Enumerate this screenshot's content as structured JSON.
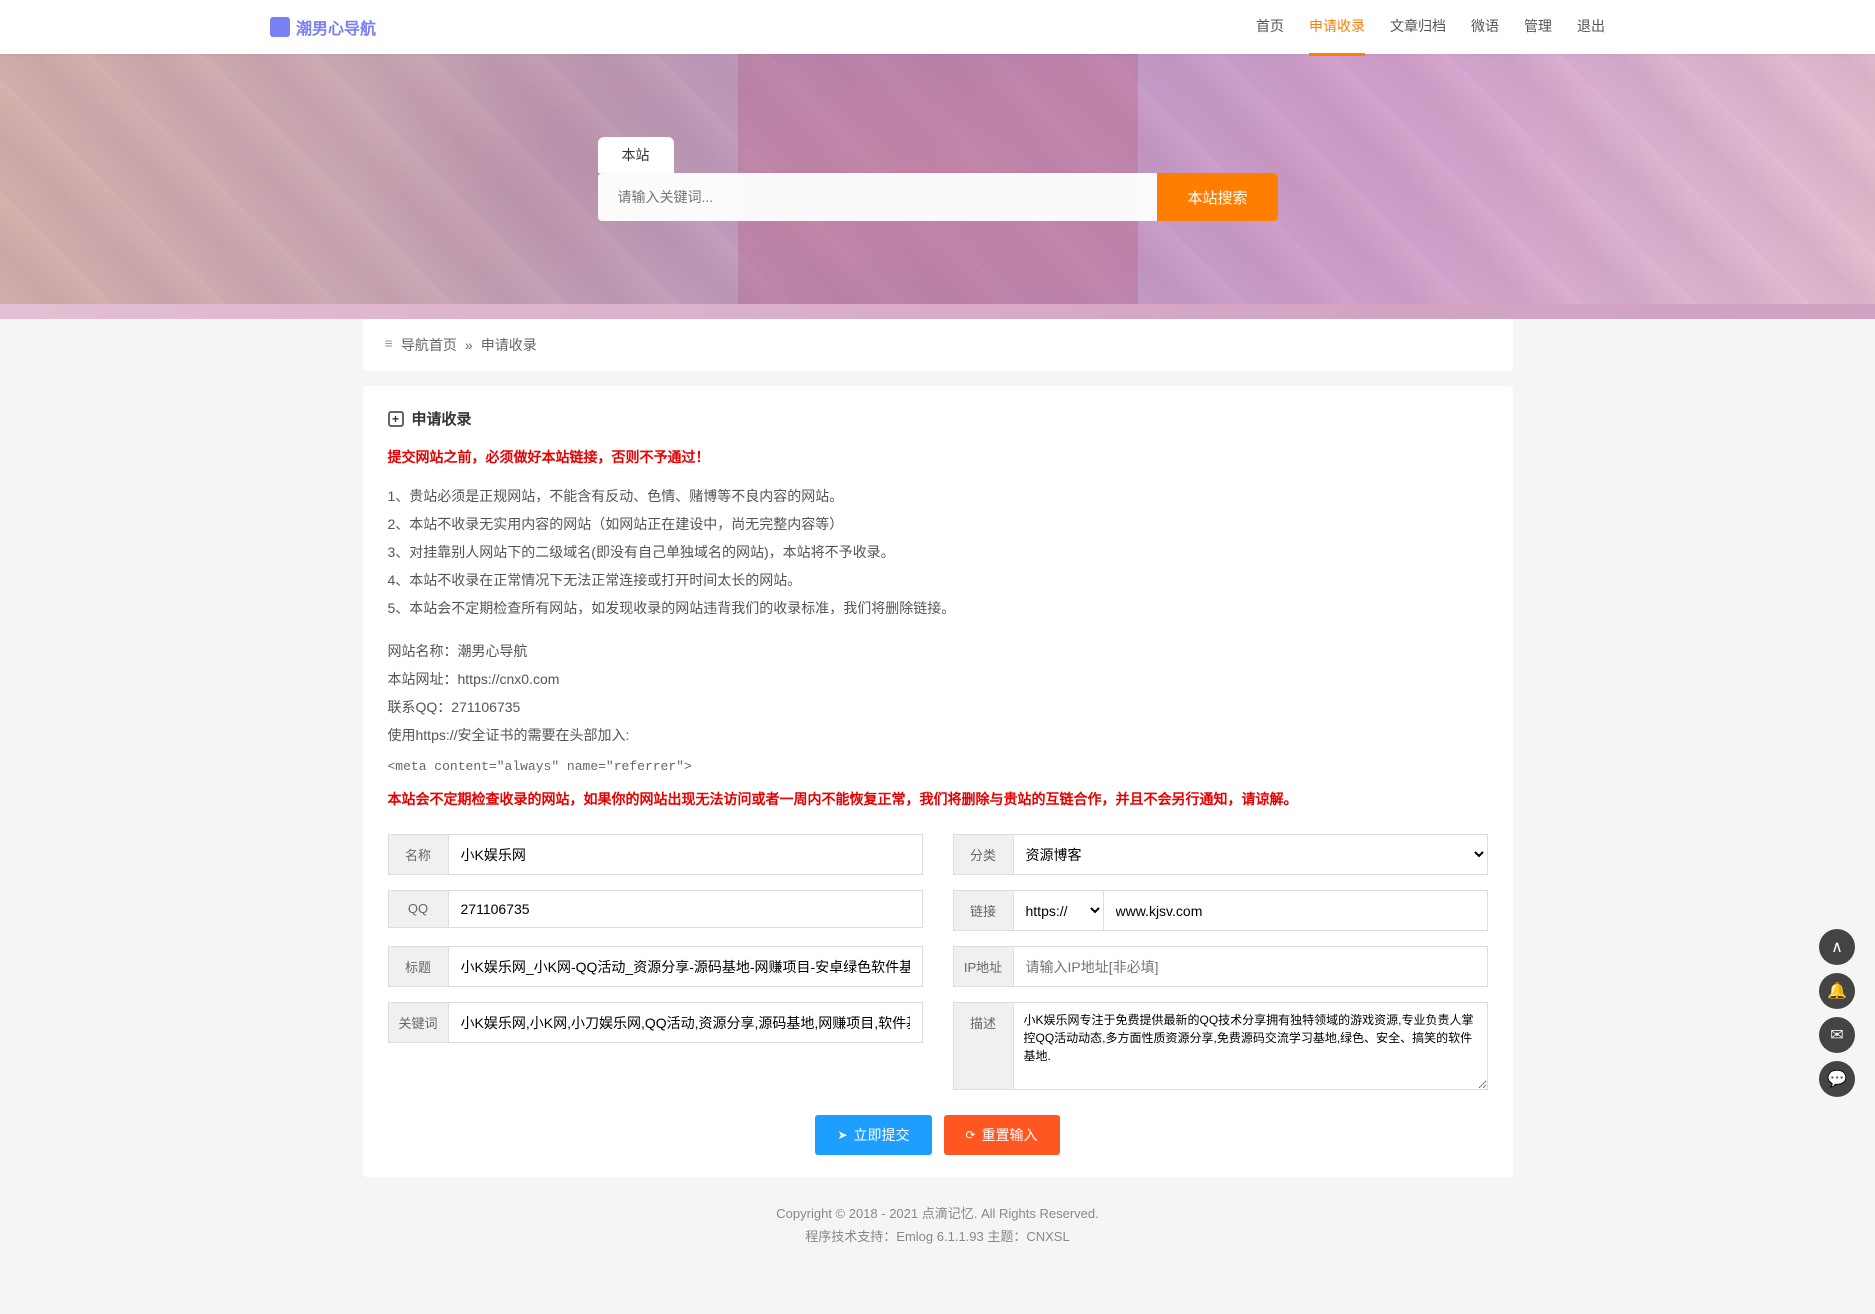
{
  "nav": {
    "logo": "潮男心导航",
    "items": [
      {
        "label": "首页"
      },
      {
        "label": "申请收录"
      },
      {
        "label": "文章归档"
      },
      {
        "label": "微语"
      },
      {
        "label": "管理"
      },
      {
        "label": "退出"
      }
    ]
  },
  "search": {
    "tab": "本站",
    "placeholder": "请输入关键词...",
    "button": "本站搜索"
  },
  "breadcrumb": {
    "home": "导航首页",
    "sep": "»",
    "current": "申请收录"
  },
  "panel": {
    "title": "申请收录",
    "warn_top": "提交网站之前，必须做好本站链接，否则不予通过！",
    "rules": [
      "1、贵站必须是正规网站，不能含有反动、色情、赌博等不良内容的网站。",
      "2、本站不收录无实用内容的网站（如网站正在建设中，尚无完整内容等）",
      "3、对挂靠别人网站下的二级域名(即没有自己单独域名的网站)，本站将不予收录。",
      "4、本站不收录在正常情况下无法正常连接或打开时间太长的网站。",
      "5、本站会不定期检查所有网站，如发现收录的网站违背我们的收录标准，我们将删除链接。"
    ],
    "info": [
      "网站名称：潮男心导航",
      "本站网址：https://cnx0.com",
      "联系QQ：271106735",
      "使用https://安全证书的需要在头部加入:"
    ],
    "code": "<meta content=\"always\" name=\"referrer\">",
    "warn_bottom": "本站会不定期检查收录的网站，如果你的网站出现无法访问或者一周内不能恢复正常，我们将删除与贵站的互链合作，并且不会另行通知，请谅解。"
  },
  "form": {
    "labels": {
      "name": "名称",
      "category": "分类",
      "qq": "QQ",
      "link": "链接",
      "title": "标题",
      "ip": "IP地址",
      "keywords": "关键词",
      "desc": "描述"
    },
    "values": {
      "name": "小K娱乐网",
      "category": "资源博客",
      "qq": "271106735",
      "protocol": "https://",
      "link": "www.kjsv.com",
      "title": "小K娱乐网_小K网-QQ活动_资源分享-源码基地-网赚项目-安卓绿色软件基地",
      "ip_placeholder": "请输入IP地址[非必填]",
      "keywords": "小K娱乐网,小K网,小刀娱乐网,QQ活动,资源分享,源码基地,网赚项目,软件基地",
      "desc": "小K娱乐网专注于免费提供最新的QQ技术分享拥有独特领域的游戏资源,专业负责人掌控QQ活动动态,多方面性质资源分享,免费源码交流学习基地,绿色、安全、搞笑的软件基地."
    },
    "buttons": {
      "submit": "立即提交",
      "reset": "重置输入"
    }
  },
  "footer": {
    "copyright": "Copyright © 2018 - 2021 点滴记忆. All Rights Reserved.",
    "tech": "程序技术支持：Emlog 6.1.1.93 主题：CNXSL"
  }
}
